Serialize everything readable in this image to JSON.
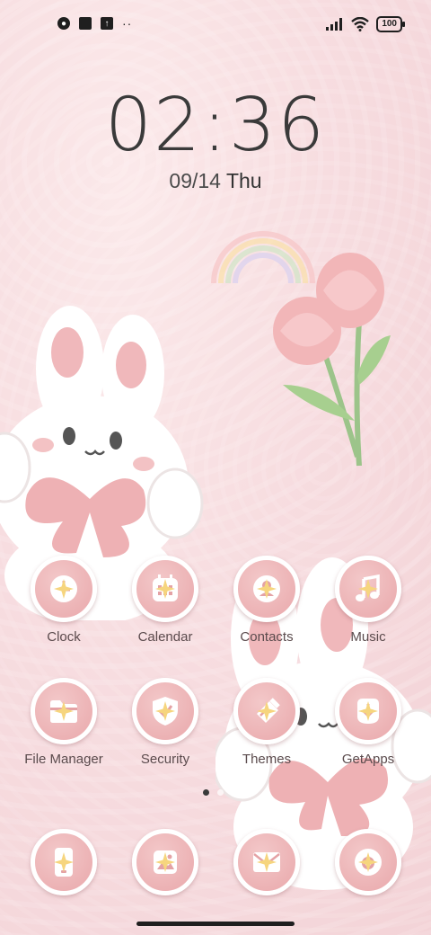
{
  "status_bar": {
    "battery": "100"
  },
  "lock": {
    "time": "02:36",
    "date": "09/14",
    "day": "Thu"
  },
  "apps": [
    {
      "label": "Clock",
      "icon": "clock-icon"
    },
    {
      "label": "Calendar",
      "icon": "calendar-icon"
    },
    {
      "label": "Contacts",
      "icon": "contacts-icon"
    },
    {
      "label": "Music",
      "icon": "music-icon"
    },
    {
      "label": "File Manager",
      "icon": "folder-icon"
    },
    {
      "label": "Security",
      "icon": "shield-icon"
    },
    {
      "label": "Themes",
      "icon": "brush-icon"
    },
    {
      "label": "GetApps",
      "icon": "download-icon"
    }
  ],
  "dock": [
    {
      "icon": "phone-icon"
    },
    {
      "icon": "gallery-icon"
    },
    {
      "icon": "mail-icon"
    },
    {
      "icon": "camera-icon"
    }
  ],
  "pager": {
    "pages": 2,
    "active": 1
  },
  "colors": {
    "background": "#f7dde0",
    "icon_fill": "#e9a8ab",
    "label": "#5b4b4d"
  }
}
